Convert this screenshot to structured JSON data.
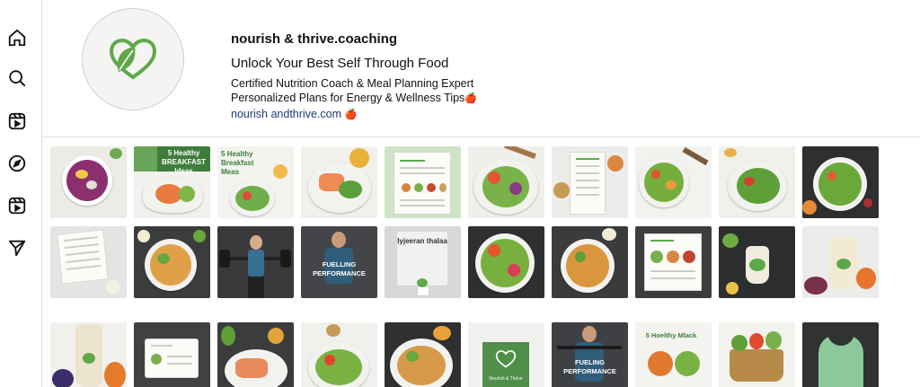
{
  "sidebar": {
    "items": [
      {
        "name": "home",
        "icon": "home-icon"
      },
      {
        "name": "search",
        "icon": "search-icon"
      },
      {
        "name": "reels",
        "icon": "reels-icon"
      },
      {
        "name": "explore",
        "icon": "compass-icon"
      },
      {
        "name": "video",
        "icon": "video-icon"
      },
      {
        "name": "messages",
        "icon": "send-icon"
      }
    ]
  },
  "profile": {
    "username": "nourish & thrive.coaching",
    "tagline": "Unlock Your Best Self Through Food",
    "bio_line_1": "Certified Nutrition Coach & Meal Planning Expert",
    "bio_line_2": "Personalized Plans for Energy & Wellness Tips",
    "link": "nourish andthrive.com",
    "emoji": "🍎",
    "brand_color": "#5fa84a"
  },
  "posts": {
    "captions": {
      "breakfast_1": "5 Healthy BREAKFAST Ideas",
      "breakfast_2": "5 Healthy Breakfast Meas",
      "fuelling_1": "FUELLING PERFORMANCE",
      "fuelling_2": "FUELING PERFORMANCE",
      "poster": "Iyjeeran thalaa",
      "snack": "5 Hoelthy Mlack",
      "brand_card": "Nourish & Thrive"
    }
  }
}
